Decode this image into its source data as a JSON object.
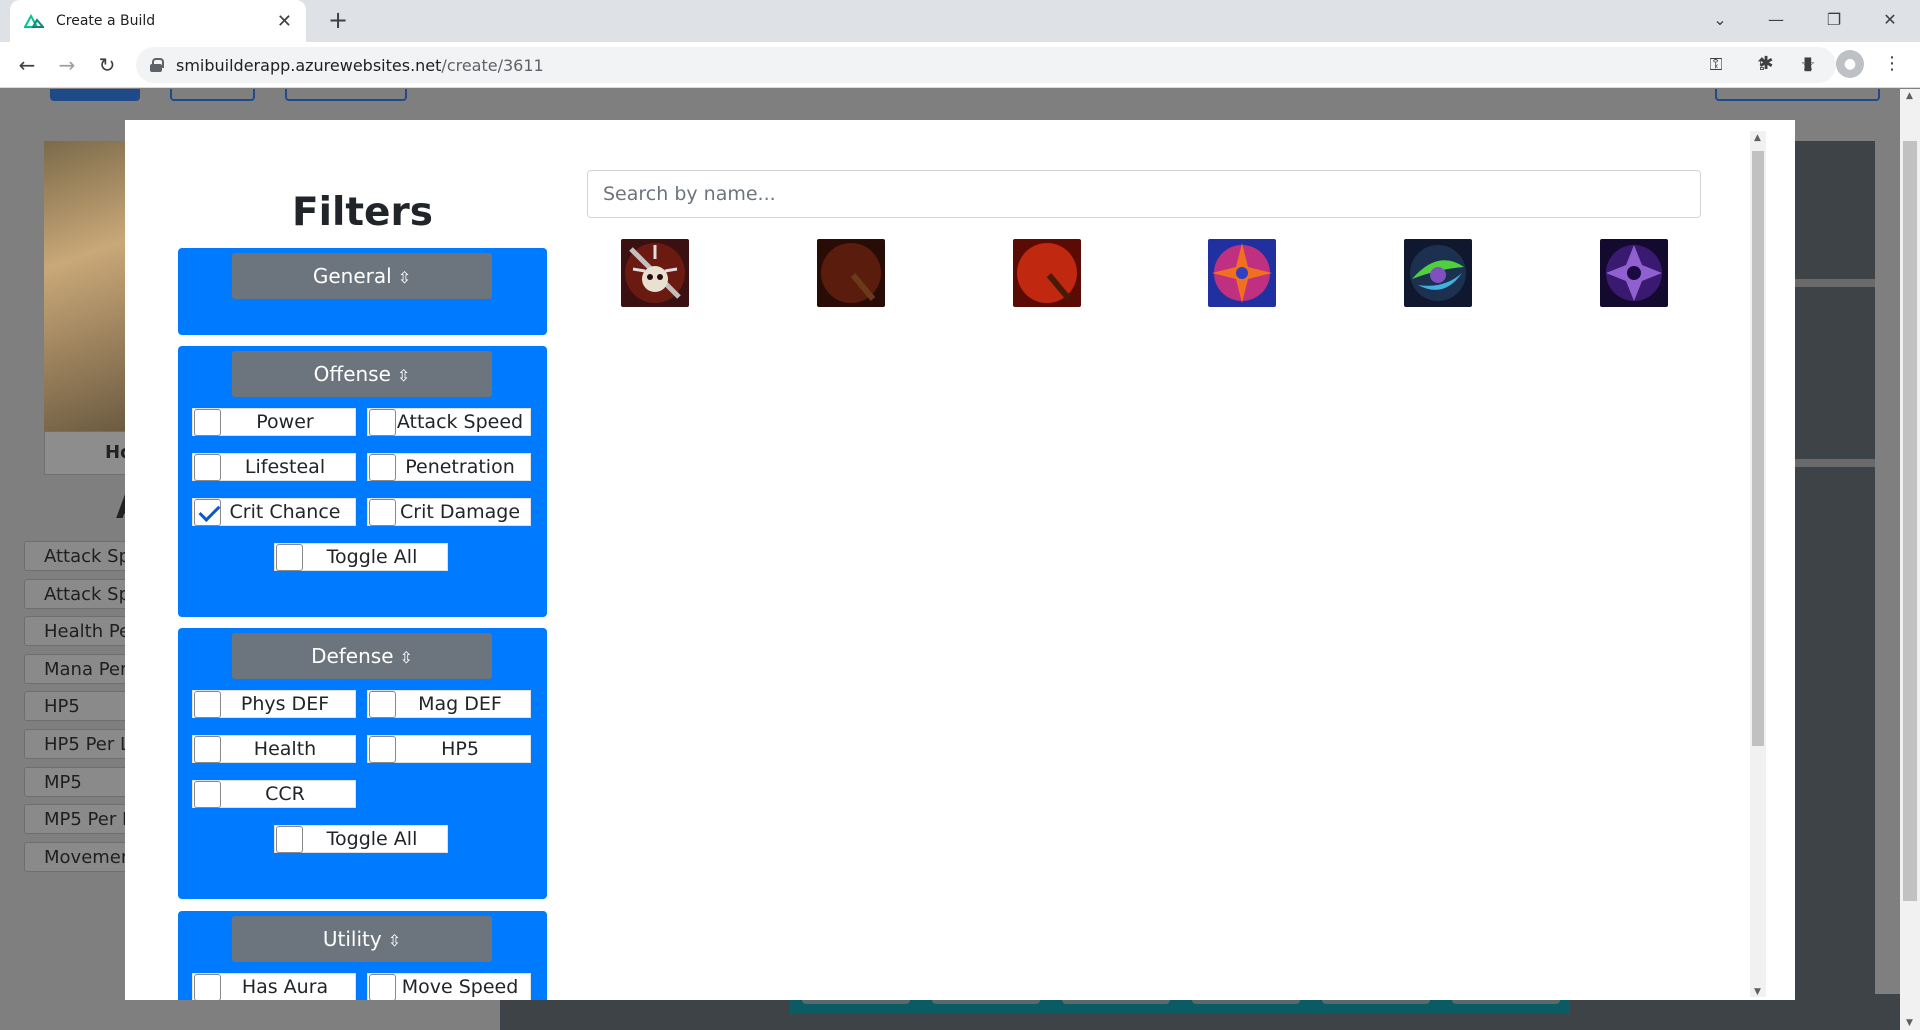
{
  "browser": {
    "tab_title": "Create a Build",
    "url_host": "smibuilderapp.azurewebsites.net",
    "url_path": "/create/3611",
    "new_tab": "+",
    "tab_close": "✕"
  },
  "background": {
    "portrait_caption": "Ho",
    "heading_letter": "A",
    "stat_list": [
      "Attack Sp",
      "Attack Sp",
      "Health Pe",
      "Mana Per",
      "HP5",
      "HP5 Per L",
      "MP5",
      "MP5 Per I",
      "Movemen"
    ]
  },
  "modal": {
    "filters_title": "Filters",
    "search_placeholder": "Search by name...",
    "sort_icon": "⇳",
    "groups": {
      "general": {
        "label": "General"
      },
      "offense": {
        "label": "Offense",
        "options": [
          {
            "label": "Power",
            "checked": false
          },
          {
            "label": "Attack Speed",
            "checked": false
          },
          {
            "label": "Lifesteal",
            "checked": false
          },
          {
            "label": "Penetration",
            "checked": false
          },
          {
            "label": "Crit Chance",
            "checked": true
          },
          {
            "label": "Crit Damage",
            "checked": false
          }
        ],
        "toggle_all": "Toggle All"
      },
      "defense": {
        "label": "Defense",
        "options": [
          {
            "label": "Phys DEF",
            "checked": false
          },
          {
            "label": "Mag DEF",
            "checked": false
          },
          {
            "label": "Health",
            "checked": false
          },
          {
            "label": "HP5",
            "checked": false
          },
          {
            "label": "CCR",
            "checked": false
          }
        ],
        "toggle_all": "Toggle All"
      },
      "utility": {
        "label": "Utility",
        "options": [
          {
            "label": "Has Aura",
            "checked": false
          },
          {
            "label": "Move Speed",
            "checked": false
          }
        ]
      }
    },
    "items": [
      {
        "icon": "skull-mace-item-icon",
        "colors": [
          "#3a1010",
          "#b03020"
        ]
      },
      {
        "icon": "scythe-item-icon",
        "colors": [
          "#2a0c06",
          "#7a2a14"
        ]
      },
      {
        "icon": "flaming-scythe-item-icon",
        "colors": [
          "#5a0c04",
          "#e04018"
        ]
      },
      {
        "icon": "orange-shuriken-item-icon",
        "colors": [
          "#2030a0",
          "#e06020"
        ]
      },
      {
        "icon": "green-shuriken-item-icon",
        "colors": [
          "#101830",
          "#40c040"
        ]
      },
      {
        "icon": "purple-shuriken-item-icon",
        "colors": [
          "#140a30",
          "#8040c0"
        ]
      }
    ]
  }
}
